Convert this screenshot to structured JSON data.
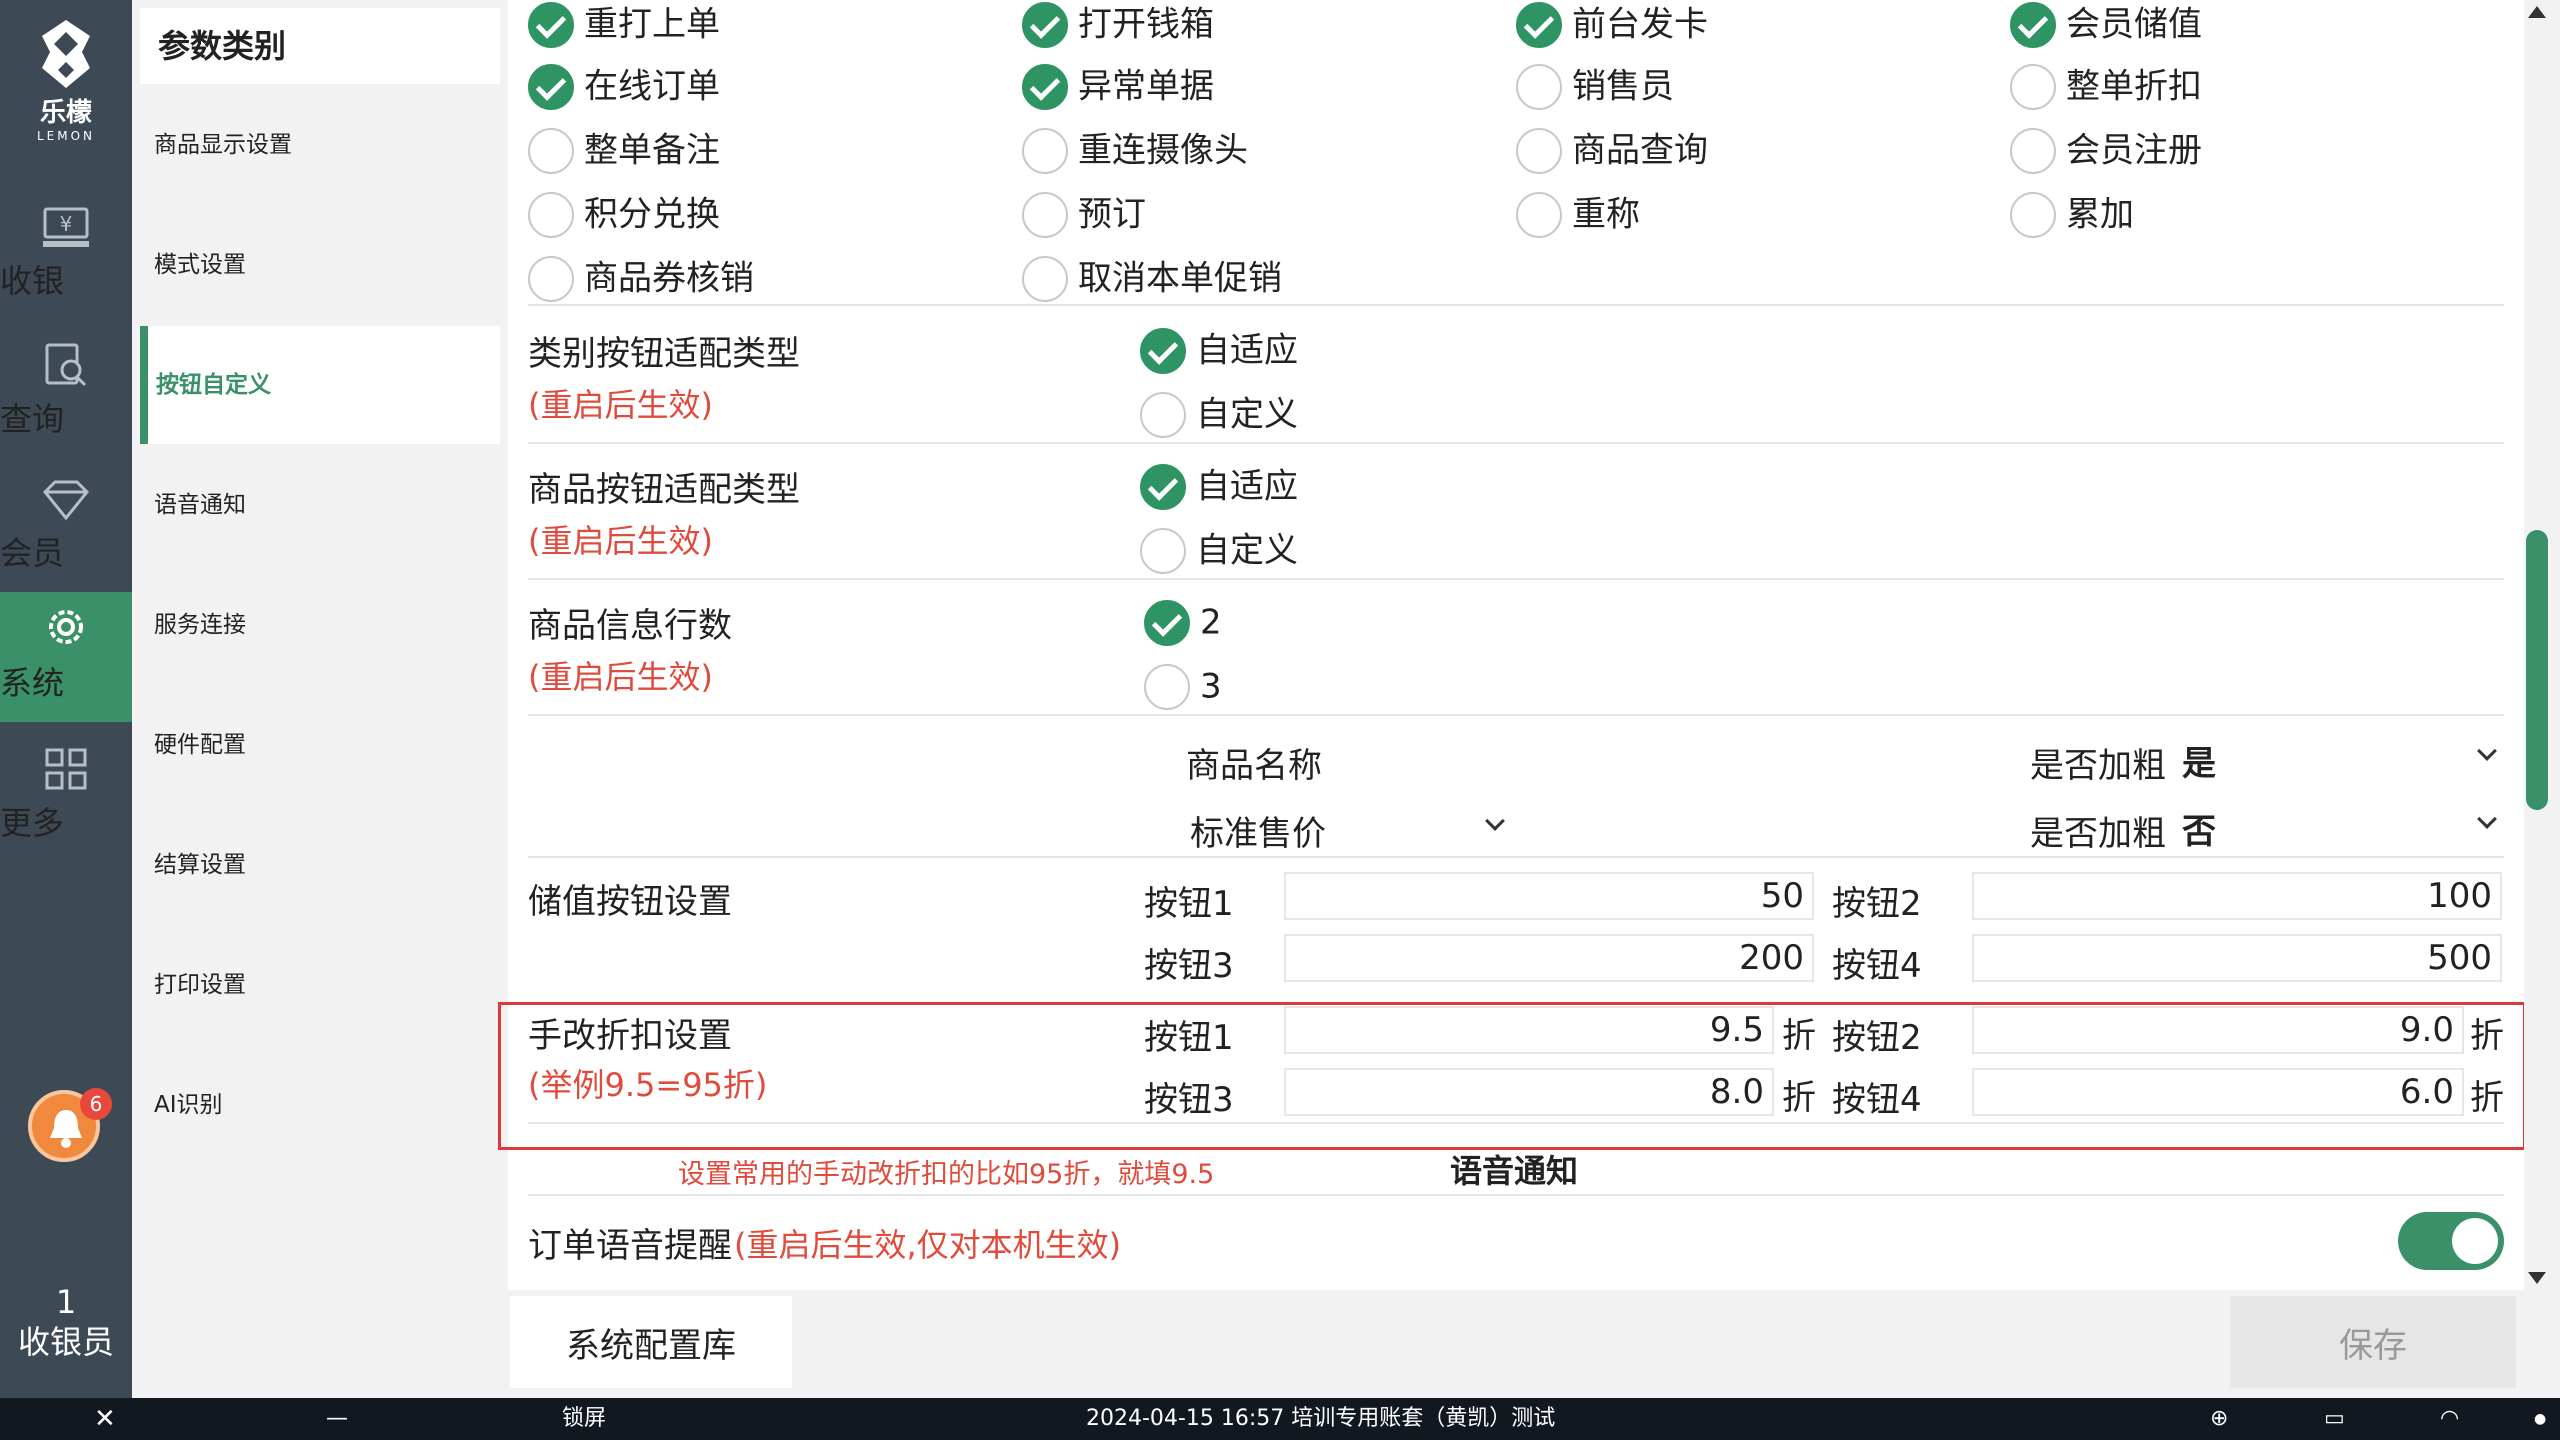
{
  "nav": {
    "logo_name": "乐檬",
    "logo_en": "LEMON",
    "items": [
      {
        "label": "收银",
        "icon": "cash-register-icon"
      },
      {
        "label": "查询",
        "icon": "search-doc-icon"
      },
      {
        "label": "会员",
        "icon": "diamond-icon"
      },
      {
        "label": "系统",
        "icon": "gear-icon"
      },
      {
        "label": "更多",
        "icon": "grid-icon"
      }
    ],
    "bell_count": "6",
    "user_count": "1",
    "user_label": "收银员"
  },
  "categories": {
    "title": "参数类别",
    "items": [
      "商品显示设置",
      "模式设置",
      "按钮自定义",
      "语音通知",
      "服务连接",
      "硬件配置",
      "结算设置",
      "打印设置",
      "AI识别"
    ],
    "active_index": 2
  },
  "buttons_grid": [
    [
      "重打上单",
      "打开钱箱",
      "前台发卡",
      "会员储值"
    ],
    [
      "在线订单",
      "异常单据",
      "销售员",
      "整单折扣"
    ],
    [
      "整单备注",
      "重连摄像头",
      "商品查询",
      "会员注册"
    ],
    [
      "积分兑换",
      "预订",
      "重称",
      "累加"
    ],
    [
      "商品券核销",
      "取消本单促销"
    ]
  ],
  "category_btn": {
    "label": "类别按钮适配类型",
    "note": "(重启后生效)",
    "opt1": "自适应",
    "opt2": "自定义"
  },
  "product_btn": {
    "label": "商品按钮适配类型",
    "note": "(重启后生效)",
    "opt1": "自适应",
    "opt2": "自定义"
  },
  "info_rows": {
    "label": "商品信息行数",
    "note": "(重启后生效)",
    "opt1": "2",
    "opt2": "3"
  },
  "display_rows": {
    "row1_field": "商品名称",
    "row1_bold_label": "是否加粗",
    "row1_bold_value": "是",
    "row2_field": "标准售价",
    "row2_bold_label": "是否加粗",
    "row2_bold_value": "否"
  },
  "stored_value": {
    "label": "储值按钮设置",
    "b1_label": "按钮1",
    "b1": "50",
    "b2_label": "按钮2",
    "b2": "100",
    "b3_label": "按钮3",
    "b3": "200",
    "b4_label": "按钮4",
    "b4": "500"
  },
  "manual_discount": {
    "label": "手改折扣设置",
    "note": "(举例9.5=95折)",
    "b1_label": "按钮1",
    "b1": "9.5",
    "b2_label": "按钮2",
    "b2": "9.0",
    "b3_label": "按钮3",
    "b3": "8.0",
    "b4_label": "按钮4",
    "b4": "6.0",
    "unit": "折"
  },
  "annotation": "设置常用的手动改折扣的比如95折，就填9.5",
  "voice_section_title": "语音通知",
  "order_voice": {
    "label": "订单语音提醒",
    "note": "(重启后生效,仅对本机生效)"
  },
  "actions": {
    "sys_config": "系统配置库",
    "save": "保存"
  },
  "taskbar": {
    "lock": "锁屏",
    "status": "2024-04-15 16:57 培训专用账套（黄凯）测试"
  },
  "colors": {
    "accent": "#3a9068",
    "nav_bg": "#3d4a55",
    "red": "#e04b3c"
  }
}
